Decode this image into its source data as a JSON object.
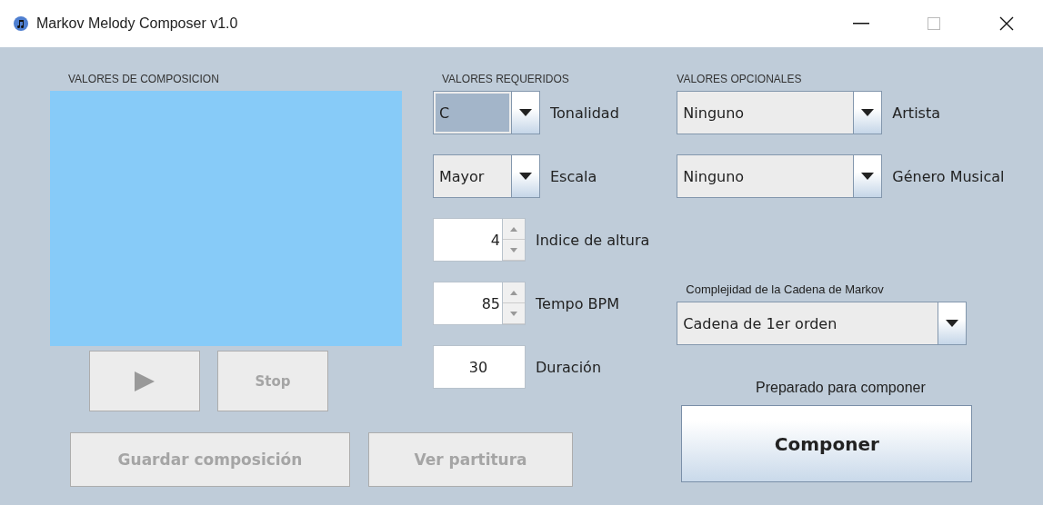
{
  "window": {
    "title": "Markov Melody Composer v1.0"
  },
  "composition": {
    "heading": "VALORES DE COMPOSICION",
    "play": {
      "disabled": true
    },
    "stop": {
      "label": "Stop",
      "disabled": true
    },
    "save": {
      "label": "Guardar composición",
      "disabled": true
    },
    "score": {
      "label": "Ver partitura",
      "disabled": true
    }
  },
  "required": {
    "heading": "VALORES REQUERIDOS",
    "fields": [
      {
        "kind": "combo",
        "value": "C",
        "label": "Tonalidad",
        "focused": true
      },
      {
        "kind": "combo",
        "value": "Mayor",
        "label": "Escala",
        "focused": false
      },
      {
        "kind": "spinner",
        "value": "4",
        "label": "Indice de altura"
      },
      {
        "kind": "spinner",
        "value": "85",
        "label": "Tempo BPM"
      },
      {
        "kind": "text",
        "value": "30",
        "label": "Duración"
      }
    ]
  },
  "optional": {
    "heading": "VALORES OPCIONALES",
    "fields": [
      {
        "value": "Ninguno",
        "label": "Artista"
      },
      {
        "value": "Ninguno",
        "label": "Género Musical"
      }
    ]
  },
  "markov": {
    "label": "Complejidad de la Cadena de Markov",
    "value": "Cadena de 1er orden"
  },
  "status": "Preparado para componer",
  "compose": {
    "label": "Componer",
    "disabled": false
  }
}
